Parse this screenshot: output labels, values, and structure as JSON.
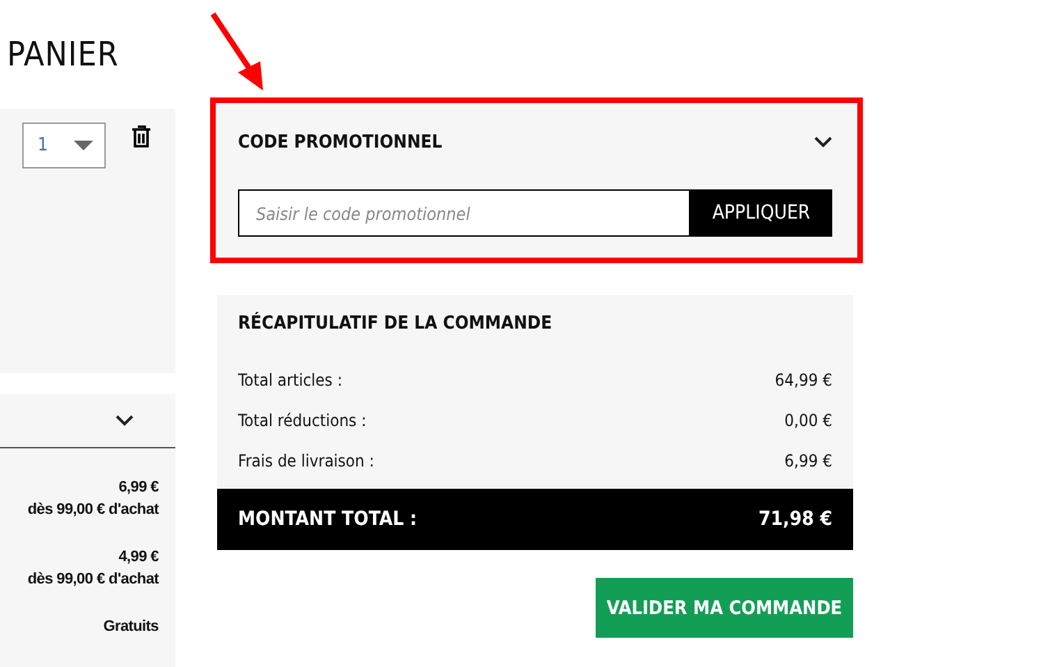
{
  "page_title": "PANIER",
  "cart_item": {
    "quantity": "1"
  },
  "shipping": {
    "rows": [
      {
        "price": "6,99 €",
        "note": "dès 99,00 € d'achat"
      },
      {
        "price": "4,99 €",
        "note": "dès 99,00 € d'achat"
      },
      {
        "price": "Gratuits"
      }
    ]
  },
  "promo": {
    "title": "CODE PROMOTIONNEL",
    "placeholder": "Saisir le code promotionnel",
    "button": "APPLIQUER"
  },
  "summary": {
    "title": "RÉCAPITULATIF DE LA COMMANDE",
    "rows": [
      {
        "label": "Total articles :",
        "value": "64,99 €"
      },
      {
        "label": "Total réductions :",
        "value": "0,00 €"
      },
      {
        "label": "Frais de livraison :",
        "value": "6,99 €"
      }
    ],
    "total_label": "MONTANT TOTAL :",
    "total_value": "71,98 €"
  },
  "submit": "VALIDER MA COMMANDE"
}
